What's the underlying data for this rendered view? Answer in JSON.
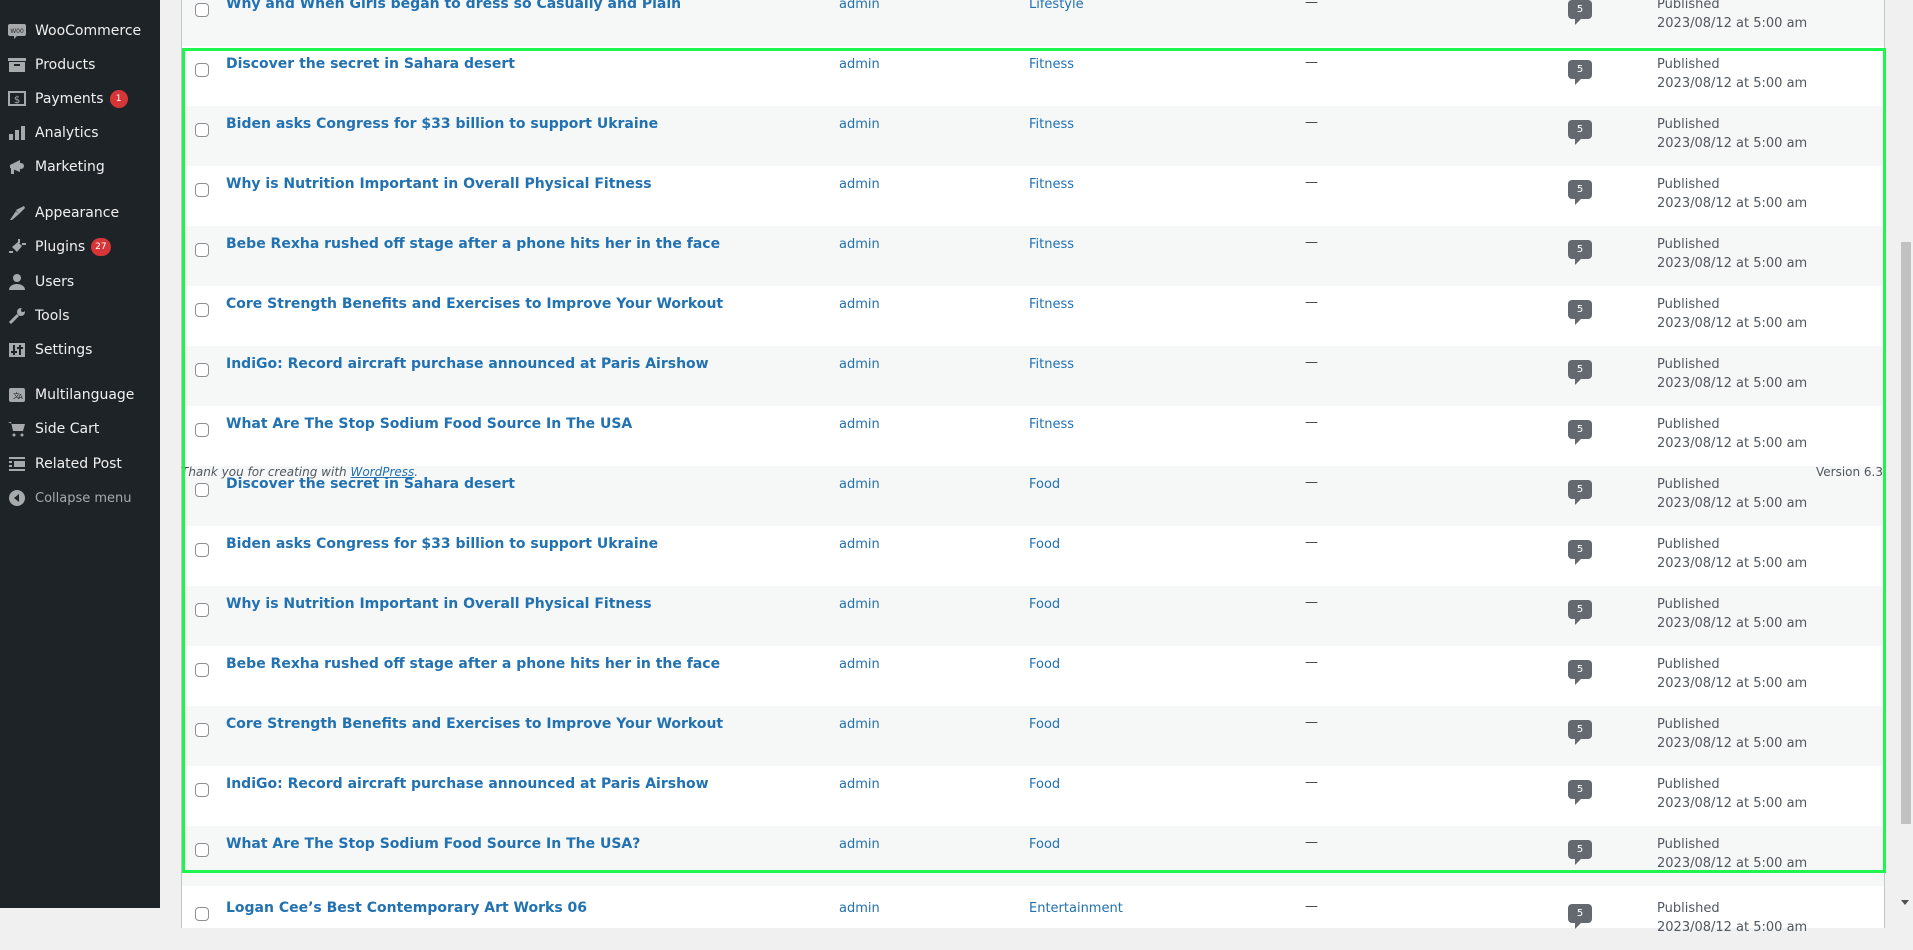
{
  "sidebar": {
    "items": [
      {
        "label": "WooCommerce",
        "icon": "woo-icon"
      },
      {
        "label": "Products",
        "icon": "archive-icon"
      },
      {
        "label": "Payments",
        "icon": "dollar-icon",
        "badge": "1"
      },
      {
        "label": "Analytics",
        "icon": "bar-chart-icon"
      },
      {
        "label": "Marketing",
        "icon": "megaphone-icon"
      },
      {
        "label": "Appearance",
        "icon": "paintbrush-icon"
      },
      {
        "label": "Plugins",
        "icon": "plug-icon",
        "badge": "27"
      },
      {
        "label": "Users",
        "icon": "user-icon"
      },
      {
        "label": "Tools",
        "icon": "wrench-icon"
      },
      {
        "label": "Settings",
        "icon": "settings-icon"
      },
      {
        "label": "Multilanguage",
        "icon": "translate-icon"
      },
      {
        "label": "Side Cart",
        "icon": "cart-icon"
      },
      {
        "label": "Related Post",
        "icon": "list-icon"
      }
    ],
    "collapse_label": "Collapse menu"
  },
  "posts": [
    {
      "title": "Why and When Girls began to dress so Casually and Plain",
      "author": "admin",
      "category": "Lifestyle",
      "tags": "—",
      "comments": "5",
      "status": "Published",
      "date": "2023/08/12 at 5:00 am"
    },
    {
      "title": "Discover the secret in Sahara desert",
      "author": "admin",
      "category": "Fitness",
      "tags": "—",
      "comments": "5",
      "status": "Published",
      "date": "2023/08/12 at 5:00 am"
    },
    {
      "title": "Biden asks Congress for $33 billion to support Ukraine",
      "author": "admin",
      "category": "Fitness",
      "tags": "—",
      "comments": "5",
      "status": "Published",
      "date": "2023/08/12 at 5:00 am"
    },
    {
      "title": "Why is Nutrition Important in Overall Physical Fitness",
      "author": "admin",
      "category": "Fitness",
      "tags": "—",
      "comments": "5",
      "status": "Published",
      "date": "2023/08/12 at 5:00 am"
    },
    {
      "title": "Bebe Rexha rushed off stage after a phone hits her in the face",
      "author": "admin",
      "category": "Fitness",
      "tags": "—",
      "comments": "5",
      "status": "Published",
      "date": "2023/08/12 at 5:00 am"
    },
    {
      "title": "Core Strength Benefits and Exercises to Improve Your Workout",
      "author": "admin",
      "category": "Fitness",
      "tags": "—",
      "comments": "5",
      "status": "Published",
      "date": "2023/08/12 at 5:00 am"
    },
    {
      "title": "IndiGo: Record aircraft purchase announced at Paris Airshow",
      "author": "admin",
      "category": "Fitness",
      "tags": "—",
      "comments": "5",
      "status": "Published",
      "date": "2023/08/12 at 5:00 am"
    },
    {
      "title": "What Are The Stop Sodium Food Source In The USA",
      "author": "admin",
      "category": "Fitness",
      "tags": "—",
      "comments": "5",
      "status": "Published",
      "date": "2023/08/12 at 5:00 am"
    },
    {
      "title": "Discover the secret in Sahara desert",
      "author": "admin",
      "category": "Food",
      "tags": "—",
      "comments": "5",
      "status": "Published",
      "date": "2023/08/12 at 5:00 am"
    },
    {
      "title": "Biden asks Congress for $33 billion to support Ukraine",
      "author": "admin",
      "category": "Food",
      "tags": "—",
      "comments": "5",
      "status": "Published",
      "date": "2023/08/12 at 5:00 am"
    },
    {
      "title": "Why is Nutrition Important in Overall Physical Fitness",
      "author": "admin",
      "category": "Food",
      "tags": "—",
      "comments": "5",
      "status": "Published",
      "date": "2023/08/12 at 5:00 am"
    },
    {
      "title": "Bebe Rexha rushed off stage after a phone hits her in the face",
      "author": "admin",
      "category": "Food",
      "tags": "—",
      "comments": "5",
      "status": "Published",
      "date": "2023/08/12 at 5:00 am"
    },
    {
      "title": "Core Strength Benefits and Exercises to Improve Your Workout",
      "author": "admin",
      "category": "Food",
      "tags": "—",
      "comments": "5",
      "status": "Published",
      "date": "2023/08/12 at 5:00 am"
    },
    {
      "title": "IndiGo: Record aircraft purchase announced at Paris Airshow",
      "author": "admin",
      "category": "Food",
      "tags": "—",
      "comments": "5",
      "status": "Published",
      "date": "2023/08/12 at 5:00 am"
    },
    {
      "title": "What Are The Stop Sodium Food Source In The USA?",
      "author": "admin",
      "category": "Food",
      "tags": "—",
      "comments": "5",
      "status": "Published",
      "date": "2023/08/12 at 5:00 am"
    },
    {
      "title": "Logan Cee’s Best Contemporary Art Works 06",
      "author": "admin",
      "category": "Entertainment",
      "tags": "—",
      "comments": "5",
      "status": "Published",
      "date": "2023/08/12 at 5:00 am"
    }
  ],
  "footer": {
    "thanks_prefix": "Thank you for creating with ",
    "thanks_link": "WordPress",
    "thanks_suffix": ".",
    "version": "Version 6.3"
  },
  "colors": {
    "sidebar_bg": "#1d2327",
    "link": "#2271b1",
    "badge": "#d63638",
    "highlight": "#1ff54f"
  }
}
